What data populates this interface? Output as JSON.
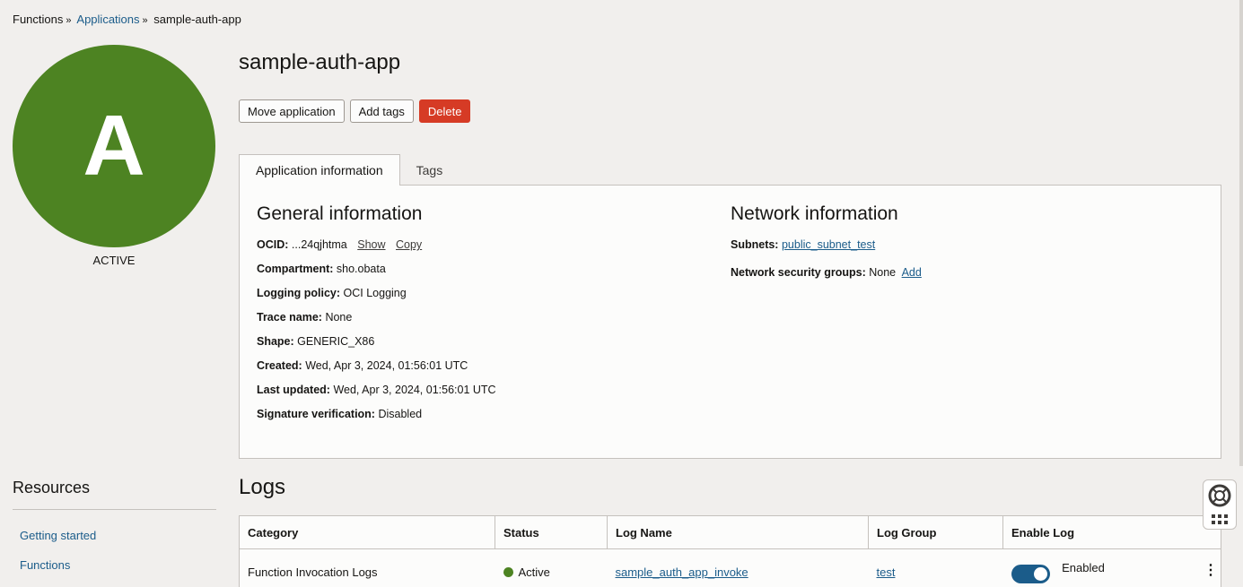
{
  "breadcrumb": {
    "root": "Functions",
    "parent": "Applications",
    "current": "sample-auth-app"
  },
  "avatar": {
    "letter": "A",
    "status": "ACTIVE",
    "color": "#4d8322"
  },
  "page": {
    "title": "sample-auth-app"
  },
  "actions": {
    "move": "Move application",
    "tags": "Add tags",
    "delete": "Delete"
  },
  "tabs": {
    "info": "Application information",
    "tags": "Tags"
  },
  "general": {
    "title": "General information",
    "ocid_label": "OCID:",
    "ocid_value": "...24qjhtma",
    "show": "Show",
    "copy": "Copy",
    "compartment_label": "Compartment:",
    "compartment_value": "sho.obata",
    "logging_label": "Logging policy:",
    "logging_value": "OCI Logging",
    "trace_label": "Trace name:",
    "trace_value": "None",
    "shape_label": "Shape:",
    "shape_value": "GENERIC_X86",
    "created_label": "Created:",
    "created_value": "Wed, Apr 3, 2024, 01:56:01 UTC",
    "updated_label": "Last updated:",
    "updated_value": "Wed, Apr 3, 2024, 01:56:01 UTC",
    "signature_label": "Signature verification:",
    "signature_value": "Disabled"
  },
  "network": {
    "title": "Network information",
    "subnets_label": "Subnets:",
    "subnets_value": "public_subnet_test",
    "nsg_label": "Network security groups:",
    "nsg_value": "None",
    "nsg_add": "Add"
  },
  "resources": {
    "title": "Resources",
    "items": [
      "Getting started",
      "Functions"
    ]
  },
  "logs": {
    "title": "Logs",
    "columns": [
      "Category",
      "Status",
      "Log Name",
      "Log Group",
      "Enable Log"
    ],
    "rows": [
      {
        "category": "Function Invocation Logs",
        "status": "Active",
        "log_name": "sample_auth_app_invoke",
        "log_group": "test",
        "enable": "Enabled"
      }
    ]
  }
}
